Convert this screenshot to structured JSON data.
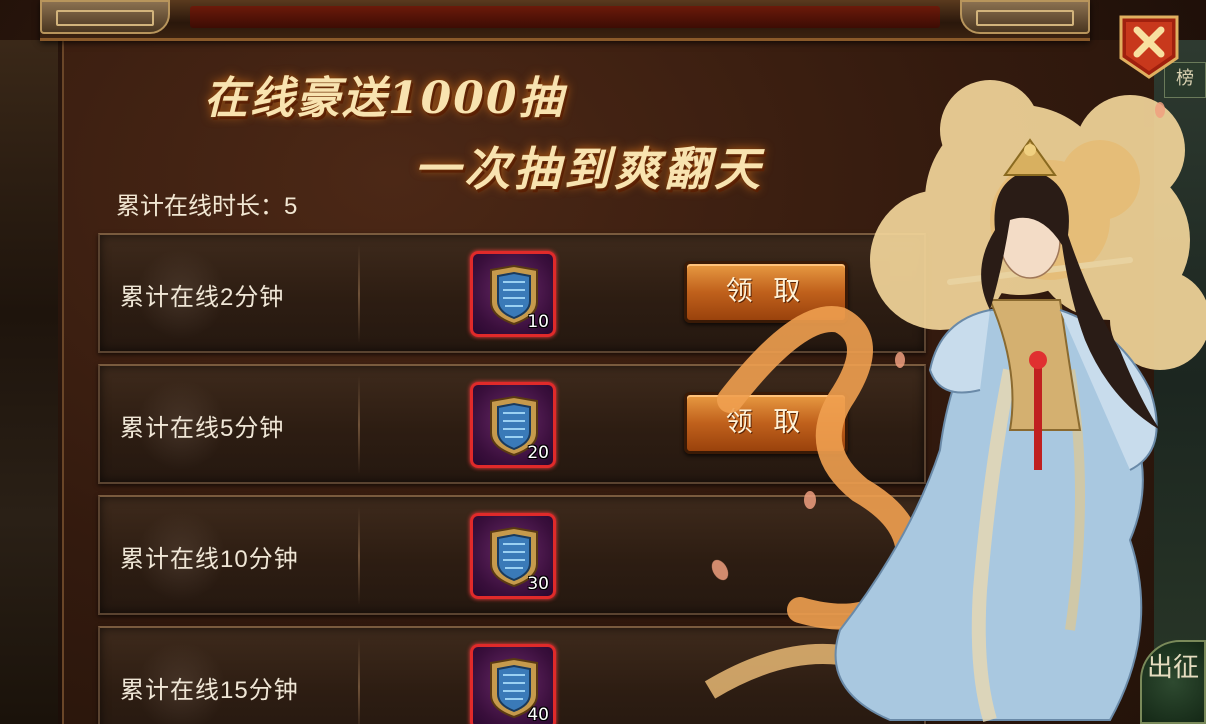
{
  "title": {
    "line1": "在线豪送1000抽",
    "line2": "一次抽到爽翻天"
  },
  "online_time": {
    "label": "累计在线时长：",
    "value": "5"
  },
  "rewards": [
    {
      "label": "累计在线2分钟",
      "item_icon": "shield-token-icon",
      "count": "10",
      "button": "领 取",
      "claimable": true
    },
    {
      "label": "累计在线5分钟",
      "item_icon": "shield-token-icon",
      "count": "20",
      "button": "领 取",
      "claimable": true
    },
    {
      "label": "累计在线10分钟",
      "item_icon": "shield-token-icon",
      "count": "30",
      "button": "",
      "claimable": false
    },
    {
      "label": "累计在线15分钟",
      "item_icon": "shield-token-icon",
      "count": "40",
      "button": "",
      "claimable": false
    }
  ],
  "close_button": {
    "icon": "close-icon"
  },
  "side_tabs": {
    "top": "榜",
    "bottom": "出征"
  },
  "colors": {
    "claim_button": "#c0611c",
    "item_border": "#e02a2a",
    "title_glow": "#c86a18",
    "panel_bg": "#331a0e"
  }
}
